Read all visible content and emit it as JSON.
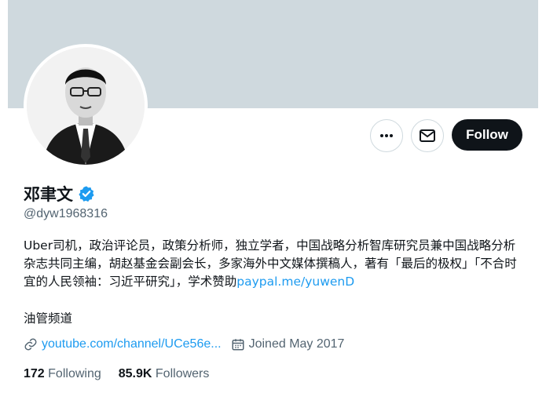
{
  "profile": {
    "display_name": "邓聿文",
    "handle": "@dyw1968316",
    "bio_text": "Uber司机，政治评论员，政策分析师，独立学者，中国战略分析智库研究员兼中国战略分析杂志共同主编，胡赵基金会副会长，多家海外中文媒体撰稿人，著有「最后的极权」「不合时宜的人民领袖：习近平研究」，学术赞助",
    "bio_link": "paypal.me/yuwenD",
    "bio_extra": "油管频道",
    "website": "youtube.com/channel/UCe56e...",
    "joined": "Joined May 2017",
    "following_count": "172",
    "following_label": "Following",
    "followers_count": "85.9K",
    "followers_label": "Followers",
    "verified": true
  },
  "actions": {
    "follow_label": "Follow",
    "more_icon": "more-dots-icon",
    "message_icon": "envelope-icon"
  },
  "colors": {
    "banner": "#cfd9de",
    "link": "#1d9bf0",
    "verified": "#1d9bf0",
    "follow_bg": "#0f1419"
  }
}
